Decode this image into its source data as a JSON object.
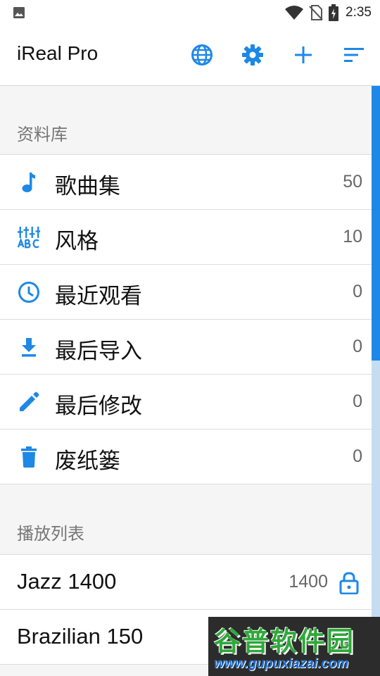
{
  "status_bar": {
    "time": "2:35",
    "icons": [
      "image-notification-icon",
      "wifi-icon",
      "no-sim-icon",
      "battery-charging-icon"
    ]
  },
  "app_bar": {
    "title": "iReal Pro",
    "actions": [
      "globe-icon",
      "settings-gear-icon",
      "add-icon",
      "sort-icon"
    ]
  },
  "library": {
    "header": "资料库",
    "items": [
      {
        "icon": "music-note-icon",
        "label": "歌曲集",
        "count": "50"
      },
      {
        "icon": "styles-icon",
        "label": "风格",
        "count": "10"
      },
      {
        "icon": "clock-icon",
        "label": "最近观看",
        "count": "0"
      },
      {
        "icon": "download-icon",
        "label": "最后导入",
        "count": "0"
      },
      {
        "icon": "pencil-icon",
        "label": "最后修改",
        "count": "0"
      },
      {
        "icon": "trash-icon",
        "label": "废纸篓",
        "count": "0"
      }
    ]
  },
  "playlists": {
    "header": "播放列表",
    "items": [
      {
        "label": "Jazz 1400",
        "count": "1400",
        "icon": "lock-icon"
      },
      {
        "label": "Brazilian 150",
        "count": "",
        "icon": ""
      }
    ]
  },
  "colors": {
    "accent": "#1e88e5",
    "scroll_track": "#c5ddf2"
  },
  "watermark": {
    "title": "谷普软件园",
    "url": "www.gupuxiazai.com"
  }
}
